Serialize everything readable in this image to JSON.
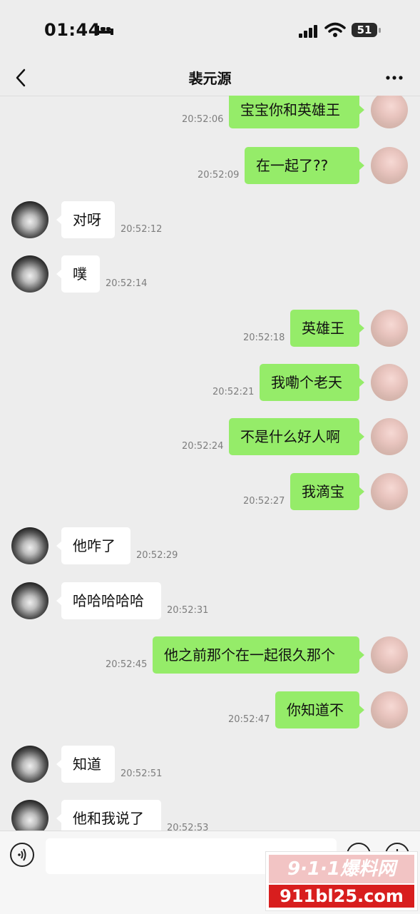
{
  "status_bar": {
    "time": "01:44",
    "battery": "51"
  },
  "nav": {
    "title": "裴元源"
  },
  "messages": [
    {
      "side": "me",
      "text": "宝宝你和英雄王",
      "time": "20:52:06"
    },
    {
      "side": "me",
      "text": "在一起了??",
      "time": "20:52:09"
    },
    {
      "side": "them",
      "text": "对呀",
      "time": "20:52:12"
    },
    {
      "side": "them",
      "text": "噗",
      "time": "20:52:14"
    },
    {
      "side": "me",
      "text": "英雄王",
      "time": "20:52:18"
    },
    {
      "side": "me",
      "text": "我嘞个老天",
      "time": "20:52:21"
    },
    {
      "side": "me",
      "text": "不是什么好人啊",
      "time": "20:52:24"
    },
    {
      "side": "me",
      "text": "我滴宝",
      "time": "20:52:27"
    },
    {
      "side": "them",
      "text": "他咋了",
      "time": "20:52:29"
    },
    {
      "side": "them",
      "text": "哈哈哈哈哈",
      "time": "20:52:31"
    },
    {
      "side": "me",
      "text": "他之前那个在一起很久那个",
      "time": "20:52:45"
    },
    {
      "side": "me",
      "text": "你知道不",
      "time": "20:52:47"
    },
    {
      "side": "them",
      "text": "知道",
      "time": "20:52:51"
    },
    {
      "side": "them",
      "text": "他和我说了",
      "time": "20:52:53"
    }
  ],
  "watermark": {
    "line1": "9·1·1爆料网",
    "line2": "911bl25.com"
  },
  "colors": {
    "background": "#ededed",
    "my_bubble": "#95ec69",
    "their_bubble": "#ffffff"
  },
  "icons": {
    "back": "chevron-left-icon",
    "more": "more-icon",
    "voice": "voice-icon",
    "emoji": "emoji-icon",
    "plus": "plus-icon",
    "signal": "signal-icon",
    "wifi": "wifi-icon",
    "sleep": "bed-icon"
  }
}
